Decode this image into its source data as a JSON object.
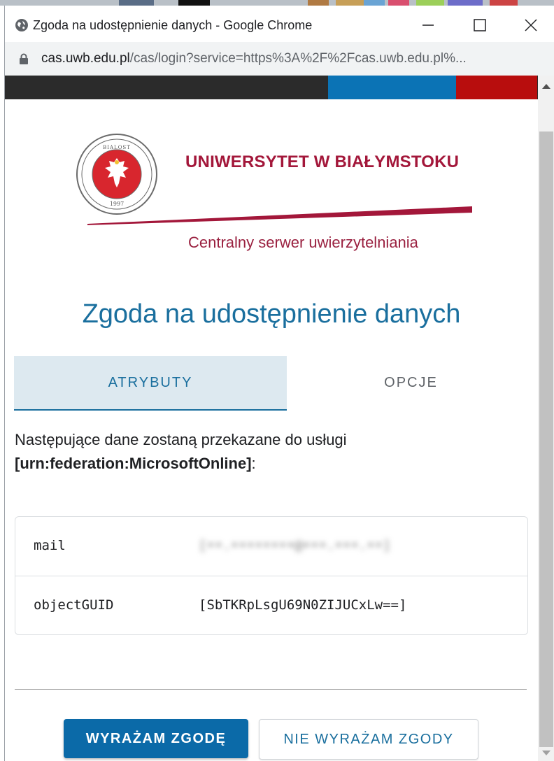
{
  "window": {
    "title": "Zgoda na udostępnienie danych - Google Chrome",
    "url_host": "cas.uwb.edu.pl",
    "url_rest": "/cas/login?service=https%3A%2F%2Fcas.uwb.edu.pl%..."
  },
  "branding": {
    "university_name": "UNIWERSYTET W BIAŁYMSTOKU",
    "subtitle": "Centralny serwer uwierzytelniania",
    "seal_text_top": "UNIVERSITAS BIALOSTOCENSIS",
    "seal_year": "1997"
  },
  "page": {
    "heading": "Zgoda na udostępnienie danych",
    "tabs": [
      {
        "label": "ATRYBUTY",
        "active": true
      },
      {
        "label": "OPCJE",
        "active": false
      }
    ],
    "intro_text": "Następujące dane zostaną przekazane do usługi",
    "service_id": "[urn:federation:MicrosoftOnline]",
    "service_suffix": ":"
  },
  "attributes": [
    {
      "name": "mail",
      "value": "[••.••••••••@•••.•••.••]",
      "blurred": true
    },
    {
      "name": "objectGUID",
      "value": "[SbTKRpLsgU69N0ZIJUCxLw==]",
      "blurred": false
    }
  ],
  "actions": {
    "accept_label": "WYRAŻAM ZGODĘ",
    "deny_label": "NIE WYRAŻAM ZGODY"
  },
  "colors": {
    "brand_red": "#a3173a",
    "accent_blue": "#1a6f9e",
    "button_blue": "#0b6aa8"
  }
}
